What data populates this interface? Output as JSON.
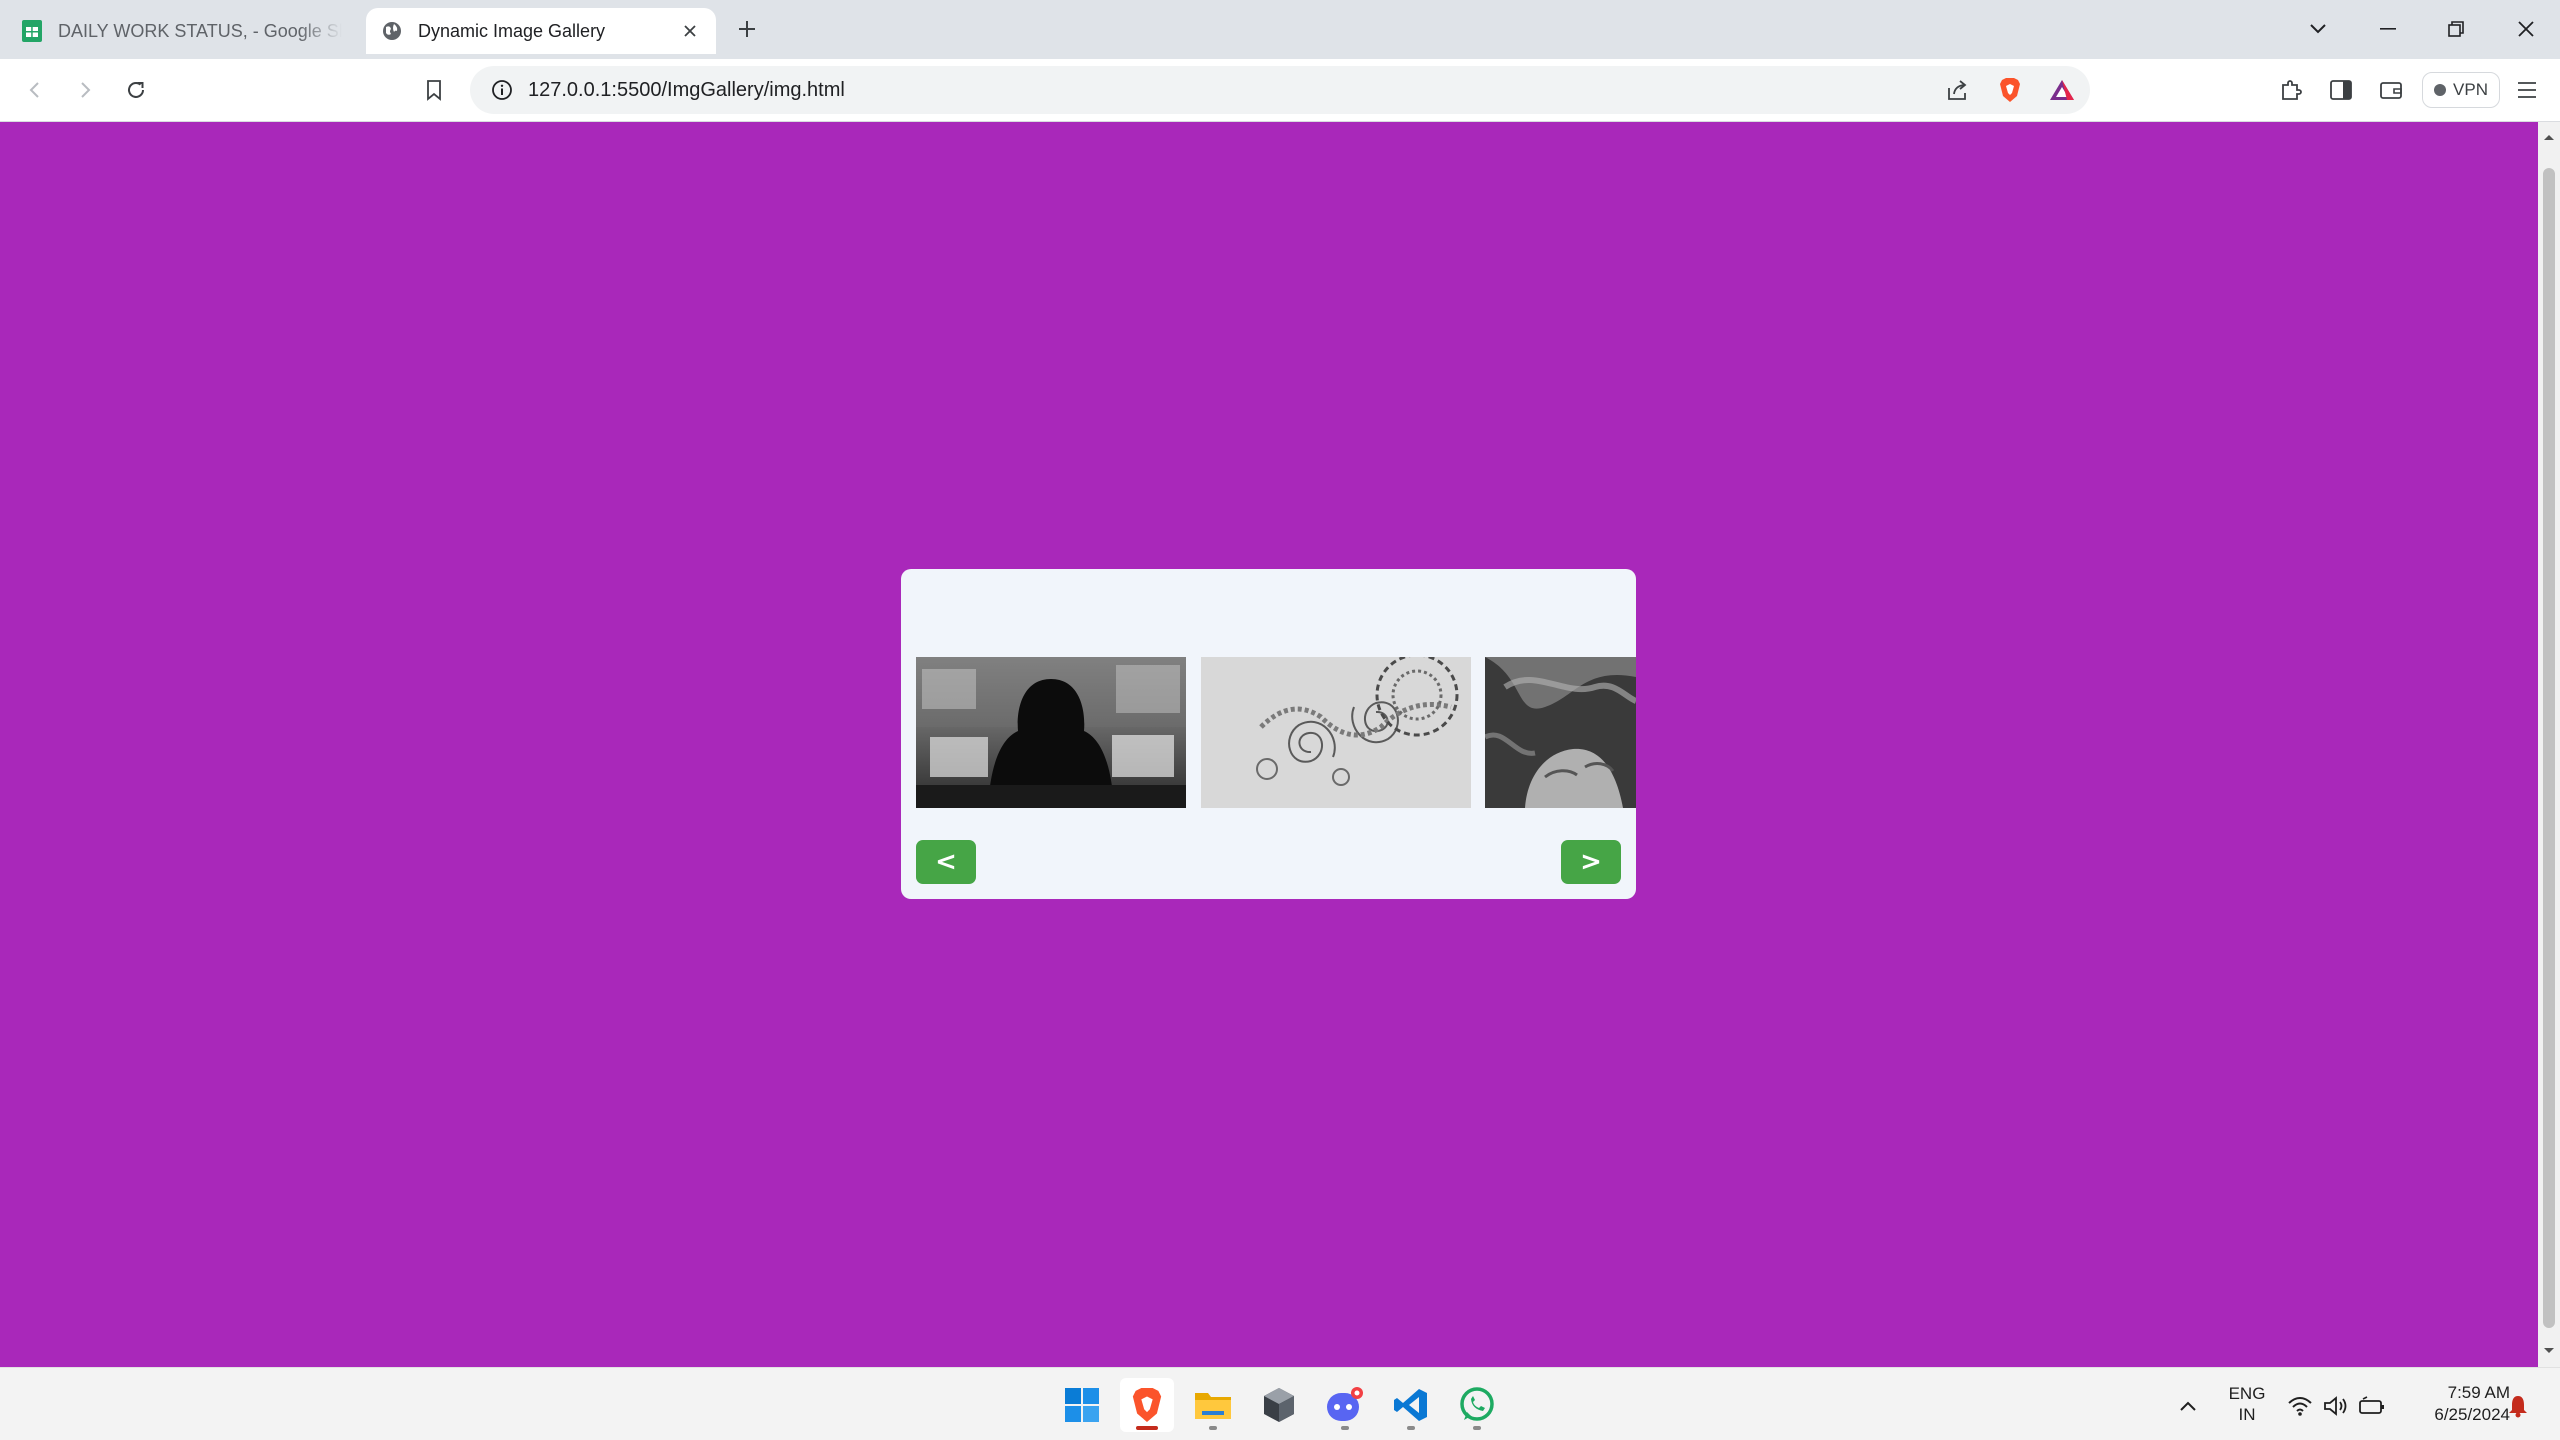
{
  "browser": {
    "tabs": [
      {
        "title": "DAILY WORK STATUS, - Google Shee",
        "icon": "google-sheets-icon",
        "active": false
      },
      {
        "title": "Dynamic Image Gallery",
        "icon": "globe-icon",
        "active": true
      }
    ],
    "address": "127.0.0.1:5500/ImgGallery/img.html",
    "vpn_label": "VPN"
  },
  "page": {
    "background": "#a928ba",
    "gallery": {
      "background": "#f1f5fb",
      "images": [
        {
          "name": "hooded-figure-image",
          "description": "grayscale"
        },
        {
          "name": "fractal-spiral-image",
          "description": "grayscale"
        },
        {
          "name": "face-smoke-image",
          "description": "grayscale"
        }
      ],
      "prev_label": "<",
      "next_label": ">",
      "button_color": "#46a546"
    }
  },
  "taskbar": {
    "apps": [
      "windows-start-icon",
      "brave-icon",
      "file-explorer-icon",
      "unity-icon",
      "discord-icon",
      "vscode-icon",
      "whatsapp-icon"
    ],
    "lang_line1": "ENG",
    "lang_line2": "IN",
    "time": "7:59 AM",
    "date": "6/25/2024"
  }
}
